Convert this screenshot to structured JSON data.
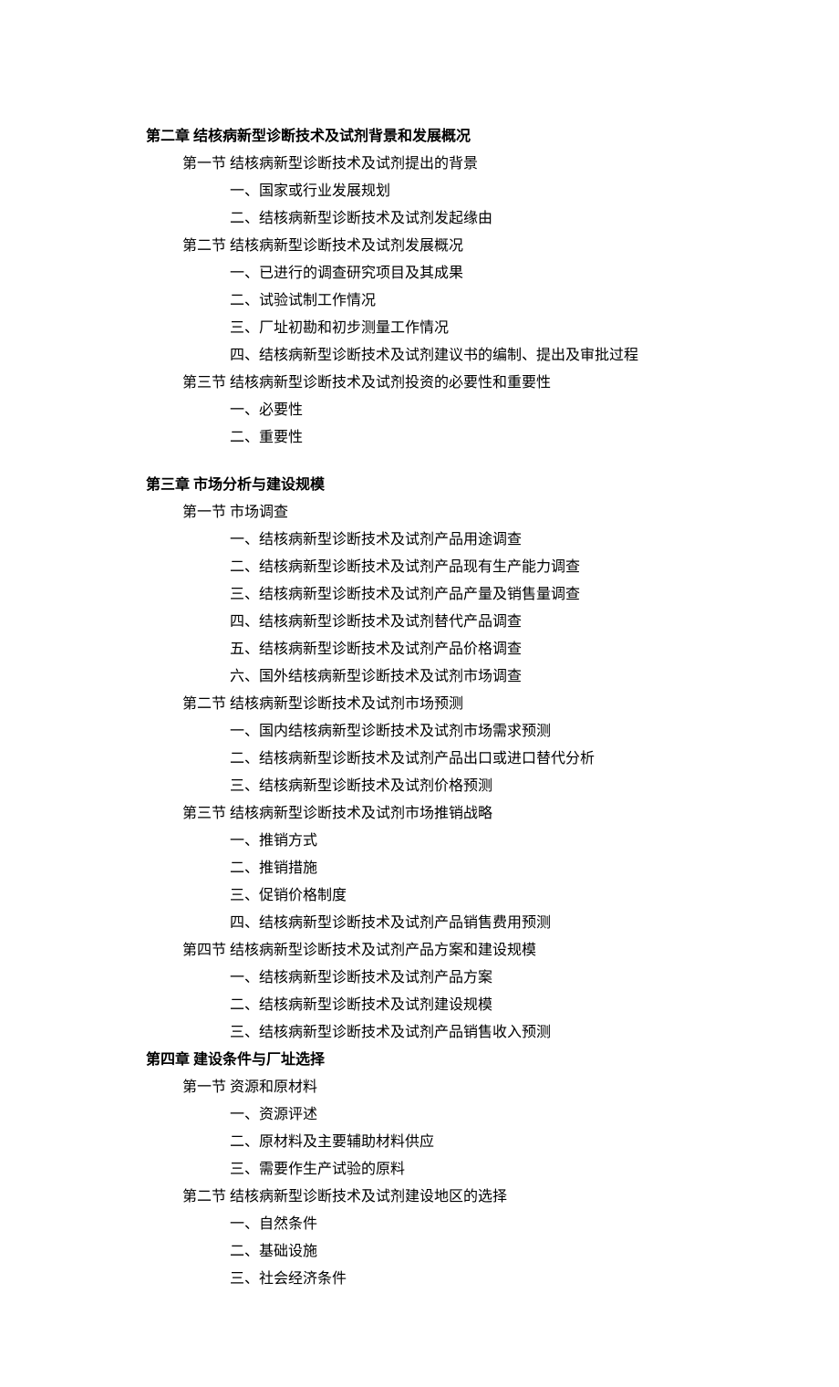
{
  "chapters": [
    {
      "title": "第二章  结核病新型诊断技术及试剂背景和发展概况",
      "spacedTop": false,
      "sections": [
        {
          "title": "第一节  结核病新型诊断技术及试剂提出的背景",
          "items": [
            "一、国家或行业发展规划",
            "二、结核病新型诊断技术及试剂发起缘由"
          ]
        },
        {
          "title": "第二节  结核病新型诊断技术及试剂发展概况",
          "items": [
            "一、已进行的调查研究项目及其成果",
            "二、试验试制工作情况",
            "三、厂址初勘和初步测量工作情况",
            "四、结核病新型诊断技术及试剂建议书的编制、提出及审批过程"
          ]
        },
        {
          "title": "第三节  结核病新型诊断技术及试剂投资的必要性和重要性",
          "items": [
            "一、必要性",
            "二、重要性"
          ]
        }
      ]
    },
    {
      "title": "第三章  市场分析与建设规模",
      "spacedTop": true,
      "sections": [
        {
          "title": "第一节  市场调查",
          "items": [
            "一、结核病新型诊断技术及试剂产品用途调查",
            "二、结核病新型诊断技术及试剂产品现有生产能力调查",
            "三、结核病新型诊断技术及试剂产品产量及销售量调查",
            "四、结核病新型诊断技术及试剂替代产品调查",
            "五、结核病新型诊断技术及试剂产品价格调查",
            "六、国外结核病新型诊断技术及试剂市场调查"
          ]
        },
        {
          "title": "第二节  结核病新型诊断技术及试剂市场预测",
          "items": [
            "一、国内结核病新型诊断技术及试剂市场需求预测",
            "二、结核病新型诊断技术及试剂产品出口或进口替代分析",
            "三、结核病新型诊断技术及试剂价格预测"
          ]
        },
        {
          "title": "第三节  结核病新型诊断技术及试剂市场推销战略",
          "items": [
            "一、推销方式",
            "二、推销措施",
            "三、促销价格制度",
            "四、结核病新型诊断技术及试剂产品销售费用预测"
          ]
        },
        {
          "title": "第四节  结核病新型诊断技术及试剂产品方案和建设规模",
          "items": [
            "一、结核病新型诊断技术及试剂产品方案",
            "二、结核病新型诊断技术及试剂建设规模",
            "三、结核病新型诊断技术及试剂产品销售收入预测"
          ]
        }
      ]
    },
    {
      "title": "第四章  建设条件与厂址选择",
      "spacedTop": false,
      "sections": [
        {
          "title": "第一节  资源和原材料",
          "items": [
            "一、资源评述",
            "二、原材料及主要辅助材料供应",
            "三、需要作生产试验的原料"
          ]
        },
        {
          "title": "第二节  结核病新型诊断技术及试剂建设地区的选择",
          "items": [
            "一、自然条件",
            "二、基础设施",
            "三、社会经济条件"
          ]
        }
      ]
    }
  ]
}
